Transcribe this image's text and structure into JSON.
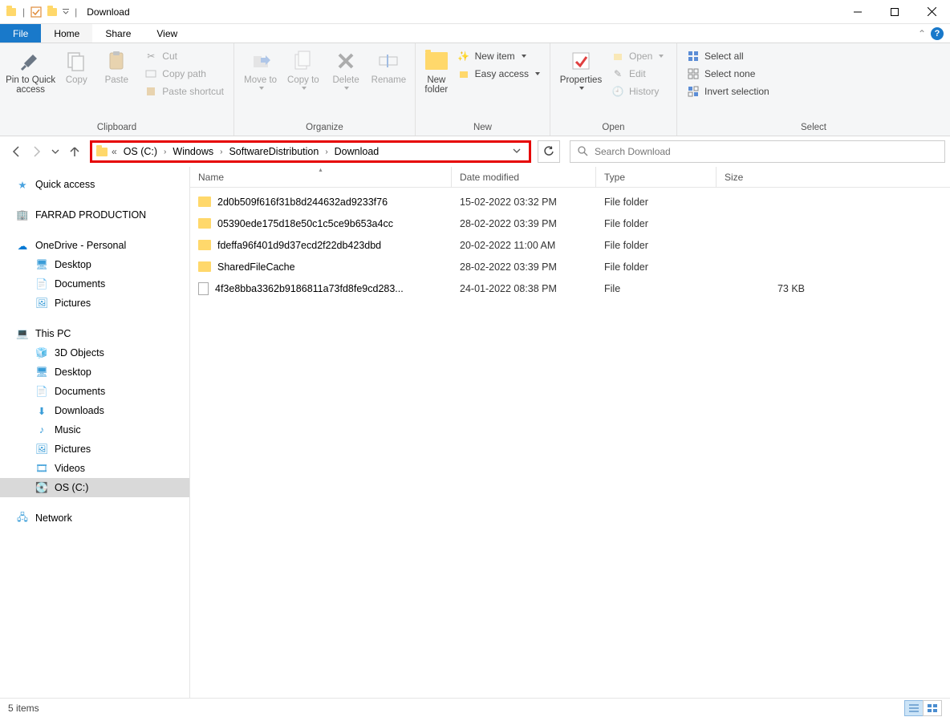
{
  "window": {
    "title": "Download"
  },
  "tabs": {
    "file": "File",
    "home": "Home",
    "share": "Share",
    "view": "View"
  },
  "ribbon": {
    "clipboard": {
      "label": "Clipboard",
      "pin": "Pin to Quick access",
      "copy": "Copy",
      "paste": "Paste",
      "cut": "Cut",
      "copypath": "Copy path",
      "pasteshortcut": "Paste shortcut"
    },
    "organize": {
      "label": "Organize",
      "moveto": "Move to",
      "copyto": "Copy to",
      "delete": "Delete",
      "rename": "Rename"
    },
    "new": {
      "label": "New",
      "newfolder": "New folder",
      "newitem": "New item",
      "easyaccess": "Easy access"
    },
    "open": {
      "label": "Open",
      "properties": "Properties",
      "open": "Open",
      "edit": "Edit",
      "history": "History"
    },
    "select": {
      "label": "Select",
      "selectall": "Select all",
      "selectnone": "Select none",
      "invert": "Invert selection"
    }
  },
  "breadcrumb": {
    "b0": "OS (C:)",
    "b1": "Windows",
    "b2": "SoftwareDistribution",
    "b3": "Download"
  },
  "search_placeholder": "Search Download",
  "sidebar": {
    "quick": "Quick access",
    "farrad": "FARRAD PRODUCTION",
    "onedrive": "OneDrive - Personal",
    "od_desktop": "Desktop",
    "od_documents": "Documents",
    "od_pictures": "Pictures",
    "thispc": "This PC",
    "pc_3d": "3D Objects",
    "pc_desktop": "Desktop",
    "pc_documents": "Documents",
    "pc_downloads": "Downloads",
    "pc_music": "Music",
    "pc_pictures": "Pictures",
    "pc_videos": "Videos",
    "pc_os": "OS (C:)",
    "network": "Network"
  },
  "columns": {
    "name": "Name",
    "date": "Date modified",
    "type": "Type",
    "size": "Size"
  },
  "files": {
    "r0": {
      "name": "2d0b509f616f31b8d244632ad9233f76",
      "date": "15-02-2022 03:32 PM",
      "type": "File folder",
      "size": ""
    },
    "r1": {
      "name": "05390ede175d18e50c1c5ce9b653a4cc",
      "date": "28-02-2022 03:39 PM",
      "type": "File folder",
      "size": ""
    },
    "r2": {
      "name": "fdeffa96f401d9d37ecd2f22db423dbd",
      "date": "20-02-2022 11:00 AM",
      "type": "File folder",
      "size": ""
    },
    "r3": {
      "name": "SharedFileCache",
      "date": "28-02-2022 03:39 PM",
      "type": "File folder",
      "size": ""
    },
    "r4": {
      "name": "4f3e8bba3362b9186811a73fd8fe9cd283...",
      "date": "24-01-2022 08:38 PM",
      "type": "File",
      "size": "73 KB"
    }
  },
  "status": "5 items"
}
